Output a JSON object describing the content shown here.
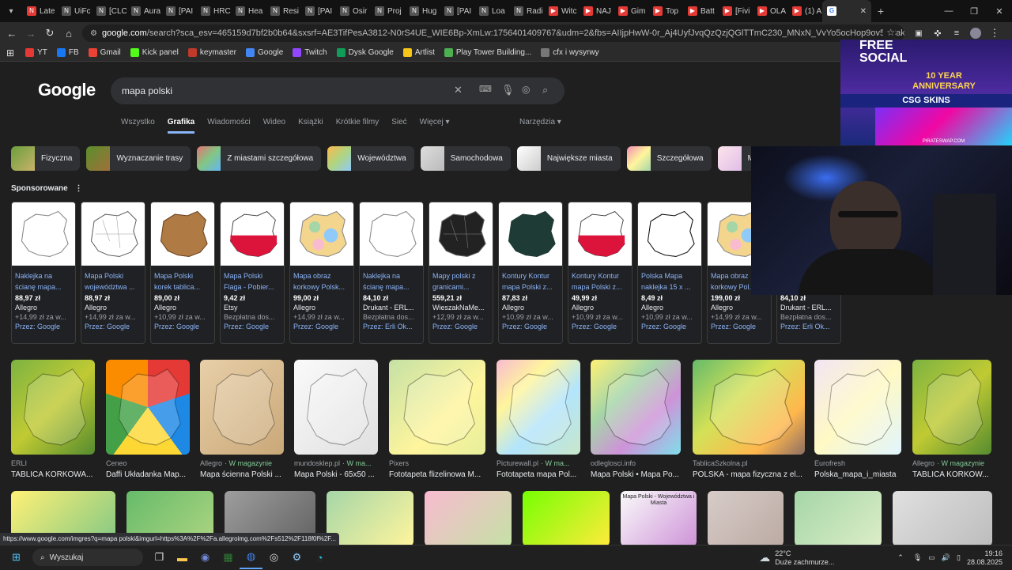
{
  "browser": {
    "tabs": [
      {
        "label": "Late",
        "color": "#e53935",
        "glyph": "N"
      },
      {
        "label": "UiFc",
        "color": "#555",
        "glyph": "N"
      },
      {
        "label": "[CLC",
        "color": "#555",
        "glyph": "N"
      },
      {
        "label": "Aura",
        "color": "#555",
        "glyph": "N"
      },
      {
        "label": "[PAI",
        "color": "#555",
        "glyph": "N"
      },
      {
        "label": "HRC",
        "color": "#555",
        "glyph": "N"
      },
      {
        "label": "Hea",
        "color": "#555",
        "glyph": "N"
      },
      {
        "label": "Resi",
        "color": "#555",
        "glyph": "N"
      },
      {
        "label": "[PAI",
        "color": "#555",
        "glyph": "N"
      },
      {
        "label": "Osir",
        "color": "#555",
        "glyph": "N"
      },
      {
        "label": "Proj",
        "color": "#555",
        "glyph": "N"
      },
      {
        "label": "Hug",
        "color": "#555",
        "glyph": "N"
      },
      {
        "label": "[PAI",
        "color": "#555",
        "glyph": "N"
      },
      {
        "label": "Loa",
        "color": "#555",
        "glyph": "N"
      },
      {
        "label": "Radi",
        "color": "#555",
        "glyph": "N"
      },
      {
        "label": "Witc",
        "color": "#e53935",
        "glyph": "▶"
      },
      {
        "label": "NAJ",
        "color": "#e53935",
        "glyph": "▶"
      },
      {
        "label": "Gim",
        "color": "#e53935",
        "glyph": "▶"
      },
      {
        "label": "Top",
        "color": "#e53935",
        "glyph": "▶"
      },
      {
        "label": "Batt",
        "color": "#e53935",
        "glyph": "▶"
      },
      {
        "label": "[Fivi",
        "color": "#e53935",
        "glyph": "▶"
      },
      {
        "label": "OLA",
        "color": "#e53935",
        "glyph": "▶"
      },
      {
        "label": "(1) A",
        "color": "#e53935",
        "glyph": "▶"
      }
    ],
    "active_tab_glyph": "G",
    "url_host": "google.com",
    "url_rest": "/search?sca_esv=465159d7bf2b0b64&sxsrf=AE3TifPesA3812-N0rS4UE_WIE6Bp-XmLw:1756401409767&udm=2&fbs=AIIjpHwW-0r_Aj4UyfJvqQzQzjQGlTTmC230_MNxN_VvYo5ocHop9ov5eCakTC7Zhh19Os6SpiT7OyrGWt6ICOS...",
    "bookmarks": [
      {
        "label": "YT",
        "color": "#e53935"
      },
      {
        "label": "FB",
        "color": "#1877f2"
      },
      {
        "label": "Gmail",
        "color": "#ea4335"
      },
      {
        "label": "Kick panel",
        "color": "#53fc18"
      },
      {
        "label": "keymaster",
        "color": "#c0392b"
      },
      {
        "label": "Google",
        "color": "#4285f4"
      },
      {
        "label": "Twitch",
        "color": "#9146ff"
      },
      {
        "label": "Dysk Google",
        "color": "#0f9d58"
      },
      {
        "label": "Artlist",
        "color": "#f5c518"
      },
      {
        "label": "Play Tower Building...",
        "color": "#4caf50"
      },
      {
        "label": "cfx i wysyrwy",
        "color": "#777"
      }
    ],
    "status_url": "https://www.google.com/imgres?q=mapa polski&imgurl=https%3A%2F%2Fa.allegroimg.com%2Fs512%2F118f0f%2F..."
  },
  "google": {
    "logo": "Google",
    "query": "mapa polski",
    "tabs": [
      "Wszystko",
      "Grafika",
      "Wiadomości",
      "Wideo",
      "Książki",
      "Krótkie filmy",
      "Sieć",
      "Więcej"
    ],
    "active_tab": "Grafika",
    "tools": "Narzędzia",
    "chips": [
      "Fizyczna",
      "Wyznaczanie trasy",
      "Z miastami szczegółowa",
      "Województwa",
      "Samochodowa",
      "Największe miasta",
      "Szczegółowa",
      "Ma"
    ],
    "sponsored_label": "Sponsorowane",
    "ads": [
      {
        "title": "Naklejka na ścianę mapa...",
        "price": "88,97 zł",
        "seller": "Allegro",
        "ship": "+14,99 zł za w...",
        "via": "Przez: Google",
        "style": "outline"
      },
      {
        "title": "Mapa Polski województwa ...",
        "price": "88,97 zł",
        "seller": "Allegro",
        "ship": "+14,99 zł za w...",
        "via": "Przez: Google",
        "style": "outline-regions"
      },
      {
        "title": "Mapa Polski korek tablica...",
        "price": "89,00 zł",
        "seller": "Allegro",
        "ship": "+10,99 zł za w...",
        "via": "Przez: Google",
        "style": "cork"
      },
      {
        "title": "Mapa Polski Flaga - Pobier...",
        "price": "9,42 zł",
        "seller": "Etsy",
        "ship": "Bezpłatna dos...",
        "via": "Przez: Google",
        "style": "flag"
      },
      {
        "title": "Mapa obraz korkowy Polsk...",
        "price": "99,00 zł",
        "seller": "Allegro",
        "ship": "+14,99 zł za w...",
        "via": "Przez: Google",
        "style": "color"
      },
      {
        "title": "Naklejka na ścianę mapa...",
        "price": "84,10 zł",
        "seller": "Drukant - ERL...",
        "ship": "Bezpłatna dos...",
        "via": "Przez: Erli Ok...",
        "style": "outline"
      },
      {
        "title": "Mapy polski z granicami...",
        "price": "559,21 zł",
        "seller": "WieszakNaMe...",
        "ship": "+12,99 zł za w...",
        "via": "Przez: Google",
        "style": "dark"
      },
      {
        "title": "Kontury Kontur mapa Polski z...",
        "price": "87,83 zł",
        "seller": "Allegro",
        "ship": "+10,99 zł za w...",
        "via": "Przez: Google",
        "style": "darkgreen"
      },
      {
        "title": "Kontury Kontur mapa Polski z...",
        "price": "49,99 zł",
        "seller": "Allegro",
        "ship": "+10,99 zł za w...",
        "via": "Przez: Google",
        "style": "flag"
      },
      {
        "title": "Polska Mapa naklejka 15 x ...",
        "price": "8,49 zł",
        "seller": "Allegro",
        "ship": "+10,99 zł za w...",
        "via": "Przez: Google",
        "style": "outline-thick"
      },
      {
        "title": "Mapa obraz korkowy Pol...",
        "price": "199,00 zł",
        "seller": "Allegro",
        "ship": "+14,99 zł za w...",
        "via": "Przez: Google",
        "style": "color"
      },
      {
        "title": "",
        "price": "84,10 zł",
        "seller": "Drukant - ERL...",
        "ship": "Bezpłatna dos...",
        "via": "Przez: Erli Ok...",
        "style": "none"
      }
    ],
    "results": [
      {
        "source": "ERLI",
        "magazine": "",
        "caption": "TABLICA KORKOWA...",
        "style": "green"
      },
      {
        "source": "Ceneo",
        "magazine": "",
        "caption": "Daffi Układanka Map...",
        "style": "puzzle"
      },
      {
        "source": "Allegro",
        "magazine": "· W magazynie",
        "caption": "Mapa ścienna Polski ...",
        "style": "beige"
      },
      {
        "source": "mundosklep.pl",
        "magazine": "· W ma...",
        "caption": "Mapa Polski - 65x50 ...",
        "style": "white"
      },
      {
        "source": "Pixers",
        "magazine": "",
        "caption": "Fototapeta flizelinowa M...",
        "style": "physical-light"
      },
      {
        "source": "Picturewall.pl",
        "magazine": "· W ma...",
        "caption": "Fototapeta mapa Pol...",
        "style": "pastel"
      },
      {
        "source": "odleglosci.info",
        "magazine": "",
        "caption": "Mapa Polski • Mapa Po...",
        "style": "pastel2"
      },
      {
        "source": "TablicaSzkolna.pl",
        "magazine": "",
        "caption": "POLSKA - mapa fizyczna z el...",
        "style": "physical"
      },
      {
        "source": "Eurofresh",
        "magazine": "",
        "caption": "Polska_mapa_i_miasta",
        "style": "admin"
      },
      {
        "source": "Allegro",
        "magazine": "· W magazynie",
        "caption": "TABLICA KORKOW...",
        "style": "green"
      }
    ],
    "row3_label": "Mapa Polski - Województwa i Miasta"
  },
  "overlay": {
    "banner_line1": "FREE",
    "banner_line2": "SOCIAL",
    "banner_anniv": "10 YEAR ANNIVERSARY",
    "banner_brand": "CSG SKINS",
    "banner_url": "PIRATESWAP.COM"
  },
  "taskbar": {
    "search_placeholder": "Wyszukaj",
    "temp": "22°C",
    "weather": "Duże zachmurze...",
    "time": "19:16",
    "date": "28.08.2025"
  }
}
